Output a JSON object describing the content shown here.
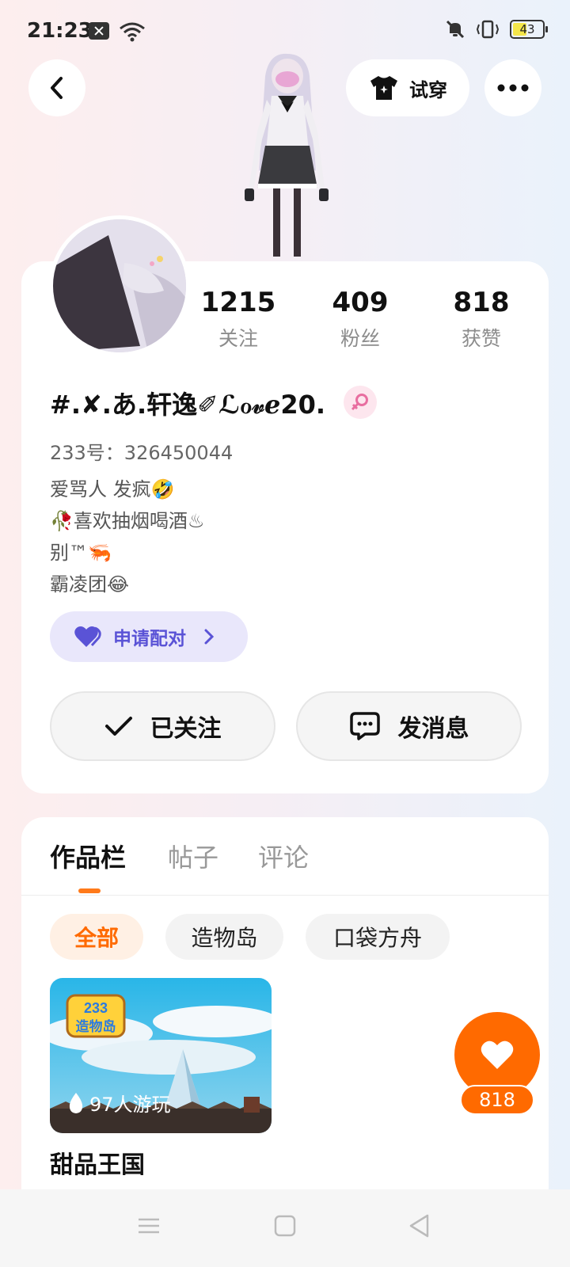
{
  "status_bar": {
    "time": "21:23",
    "battery": "43"
  },
  "header": {
    "tryon_label": "试穿",
    "icons": [
      "back-arrow-icon",
      "shirt-icon",
      "more-dots-icon"
    ]
  },
  "profile": {
    "stats": [
      {
        "value": "1215",
        "label": "关注"
      },
      {
        "value": "409",
        "label": "粉丝"
      },
      {
        "value": "818",
        "label": "获赞"
      }
    ],
    "nickname": "#.✘.あ.轩逸✐ℒℴ𝓋ℯ20.",
    "uid": "233号：326450044",
    "bio": [
      "爱骂人 发疯🤣",
      "🥀喜欢抽烟喝酒♨",
      "别™🦐",
      "霸凌团😂"
    ],
    "pair_label": "申请配对",
    "follow_label": "已关注",
    "message_label": "发消息"
  },
  "tabs": [
    "作品栏",
    "帖子",
    "评论"
  ],
  "filters": [
    "全部",
    "造物岛",
    "口袋方舟"
  ],
  "works": [
    {
      "title": "甜品王国",
      "plays": "97人游玩",
      "badge_line1": "233",
      "badge_line2": "造物岛"
    }
  ],
  "like_fab": {
    "count": "818"
  },
  "colors": {
    "accent": "#ff6a00",
    "pair": "#5a53d6"
  }
}
